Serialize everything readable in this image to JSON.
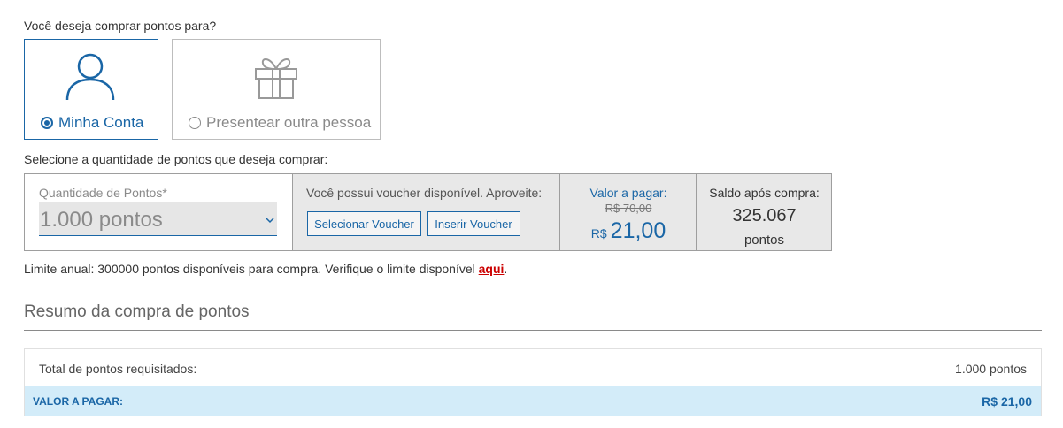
{
  "question": "Você deseja comprar pontos para?",
  "options": {
    "mine": {
      "label": "Minha Conta",
      "selected": true,
      "icon": "user-icon"
    },
    "gift": {
      "label": "Presentear outra pessoa",
      "selected": false,
      "icon": "gift-icon"
    }
  },
  "select_label": "Selecione a quantidade de pontos que deseja comprar:",
  "quantity": {
    "label": "Quantidade de Pontos*",
    "value": "1.000 pontos"
  },
  "voucher": {
    "text": "Você possui voucher disponível. Aproveite:",
    "select_button": "Selecionar Voucher",
    "insert_button": "Inserir Voucher"
  },
  "payment": {
    "label": "Valor a pagar:",
    "old_price": "R$ 70,00",
    "currency": "R$",
    "amount": "21,00"
  },
  "balance": {
    "label": "Saldo após compra:",
    "value": "325.067",
    "unit": "pontos"
  },
  "limit": {
    "text": "Limite anual: 300000 pontos disponíveis para compra. Verifique o limite disponível ",
    "link": "aqui",
    "suffix": "."
  },
  "summary": {
    "title": "Resumo da compra de pontos",
    "total_label": "Total de pontos requisitados:",
    "total_value": "1.000 pontos",
    "pay_label": "VALOR A PAGAR:",
    "pay_value": "R$ 21,00"
  },
  "colors": {
    "accent": "#1a66a6",
    "link": "#cc0000",
    "summary_highlight": "#d3ecf9"
  }
}
